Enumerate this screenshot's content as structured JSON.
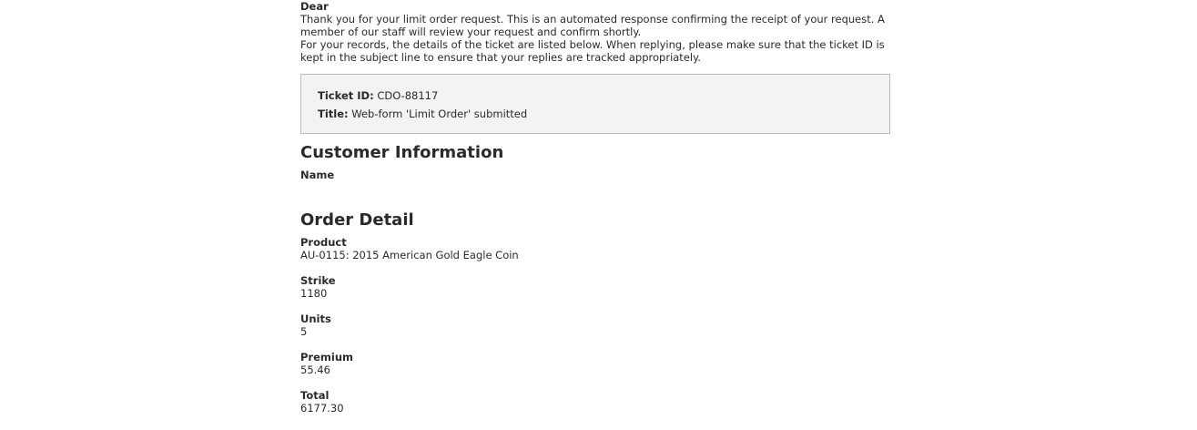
{
  "greeting": "Dear",
  "intro_paragraph_1": "Thank you for your limit order request. This is an automated response confirming the receipt of your request. A member of our staff will review your request and confirm shortly.",
  "intro_paragraph_2": "For your records, the details of the ticket are listed below. When replying, please make sure that the ticket ID is kept in the subject line to ensure that your replies are tracked appropriately.",
  "ticket": {
    "id_label": "Ticket ID:",
    "id_value": "CDO-88117",
    "title_label": "Title:",
    "title_value": "Web-form 'Limit Order' submitted"
  },
  "customer": {
    "heading": "Customer Information",
    "name_label": "Name",
    "name_value": ""
  },
  "order": {
    "heading": "Order Detail",
    "fields": [
      {
        "label": "Product",
        "value": "AU-0115: 2015 American Gold Eagle Coin"
      },
      {
        "label": "Strike",
        "value": "1180"
      },
      {
        "label": "Units",
        "value": "5"
      },
      {
        "label": "Premium",
        "value": "55.46"
      },
      {
        "label": "Total",
        "value": "6177.30"
      }
    ]
  }
}
